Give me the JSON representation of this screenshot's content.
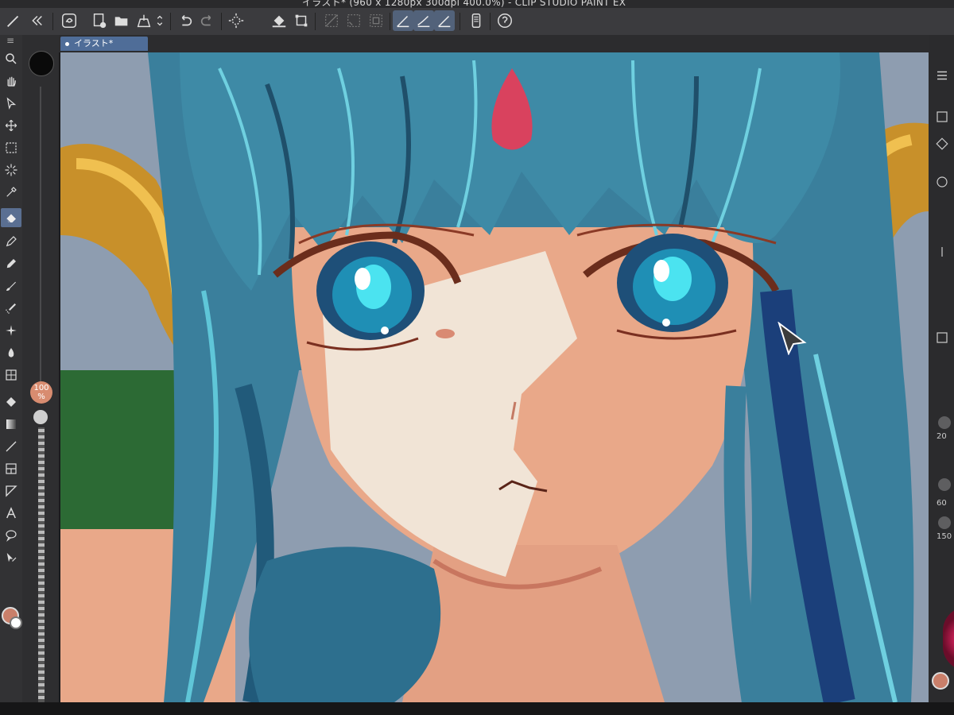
{
  "window": {
    "title": "イラスト* (960 x 1280px 300dpi 400.0%) - CLIP STUDIO PAINT EX"
  },
  "canvas_tab": {
    "label": "イラスト*"
  },
  "command_bar": {
    "icons": [
      "clip-studio-icon",
      "new-file-icon",
      "open-file-icon",
      "save-icon",
      "undo-icon",
      "redo-icon",
      "clear-icon",
      "fill-icon",
      "transform-icon",
      "hide-selection-icon",
      "snap-ruler-icon",
      "snap-special-ruler-icon",
      "snap-grid-icon",
      "pen-stroke-icon",
      "brush-stroke-icon",
      "pencil-stroke-icon",
      "smartphone-icon",
      "help-icon"
    ]
  },
  "toolbox": {
    "tools": [
      "zoom",
      "move",
      "object",
      "move-layer",
      "selection",
      "auto-select",
      "eyedropper",
      "eraser",
      "pen",
      "pencil",
      "brush",
      "airbrush",
      "decoration",
      "blend",
      "fill",
      "gradient",
      "figure",
      "frame",
      "ruler",
      "text",
      "balloon",
      "correct-line"
    ],
    "active_tool": "eraser"
  },
  "brush_panel": {
    "opacity": "100\n%"
  },
  "colors": {
    "main": "#c97f6a",
    "sub": "#ffffff",
    "accent": "#4f6d98"
  },
  "right_panel": {
    "labels": [
      "20",
      "60",
      "150"
    ]
  }
}
